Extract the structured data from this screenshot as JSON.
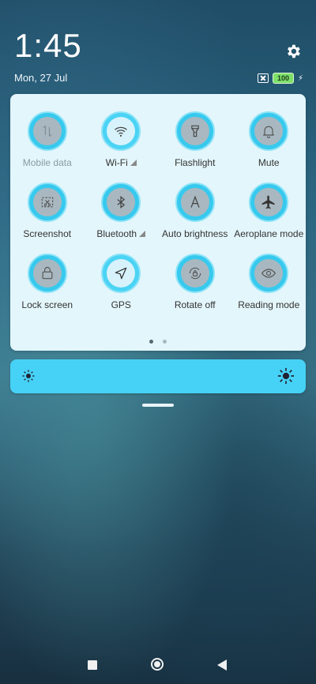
{
  "status": {
    "time": "1:45",
    "date": "Mon, 27 Jul",
    "battery": "100"
  },
  "tiles": [
    {
      "label": "Mobile data",
      "icon": "mobile-data-icon",
      "active": false,
      "dim": true
    },
    {
      "label": "Wi-Fi",
      "icon": "wifi-icon",
      "active": true,
      "dim": false,
      "expand": true
    },
    {
      "label": "Flashlight",
      "icon": "flashlight-icon",
      "active": false,
      "dim": false
    },
    {
      "label": "Mute",
      "icon": "bell-icon",
      "active": false,
      "dim": false
    },
    {
      "label": "Screenshot",
      "icon": "screenshot-icon",
      "active": false,
      "dim": false
    },
    {
      "label": "Bluetooth",
      "icon": "bluetooth-icon",
      "active": false,
      "dim": false,
      "expand": true
    },
    {
      "label": "Auto brightness",
      "icon": "auto-brightness-icon",
      "active": false,
      "dim": false
    },
    {
      "label": "Aeroplane mode",
      "icon": "aeroplane-icon",
      "active": false,
      "dim": false
    },
    {
      "label": "Lock screen",
      "icon": "lock-icon",
      "active": false,
      "dim": false
    },
    {
      "label": "GPS",
      "icon": "gps-icon",
      "active": true,
      "dim": false
    },
    {
      "label": "Rotate off",
      "icon": "rotate-lock-icon",
      "active": false,
      "dim": false
    },
    {
      "label": "Reading mode",
      "icon": "eye-icon",
      "active": false,
      "dim": false
    }
  ],
  "pager": {
    "pages": 2,
    "current": 1
  },
  "colors": {
    "accent": "#37c9ee",
    "panel": "#e3f6fb",
    "slider": "#46d2f6"
  }
}
